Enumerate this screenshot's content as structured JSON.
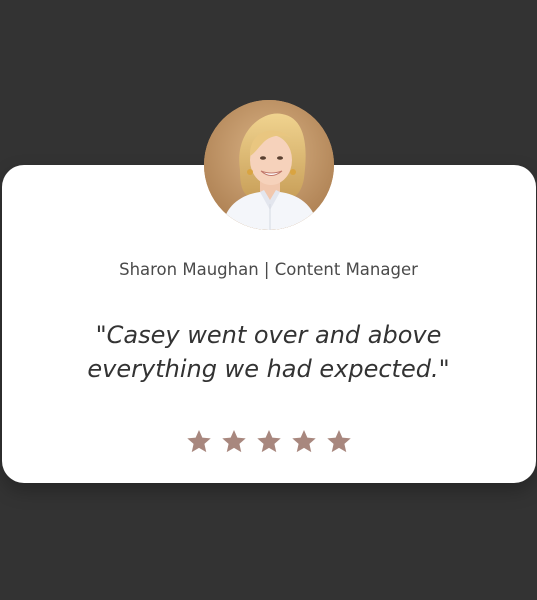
{
  "testimonial": {
    "author_line": "Sharon Maughan | Content Manager",
    "quote": "\"Casey went over and above everything we had expected.\"",
    "rating": 5,
    "rating_max": 5,
    "avatar_icon": "person-portrait-icon"
  },
  "colors": {
    "background": "#333333",
    "card": "#ffffff",
    "star": "#a8877e",
    "text": "#333333"
  }
}
